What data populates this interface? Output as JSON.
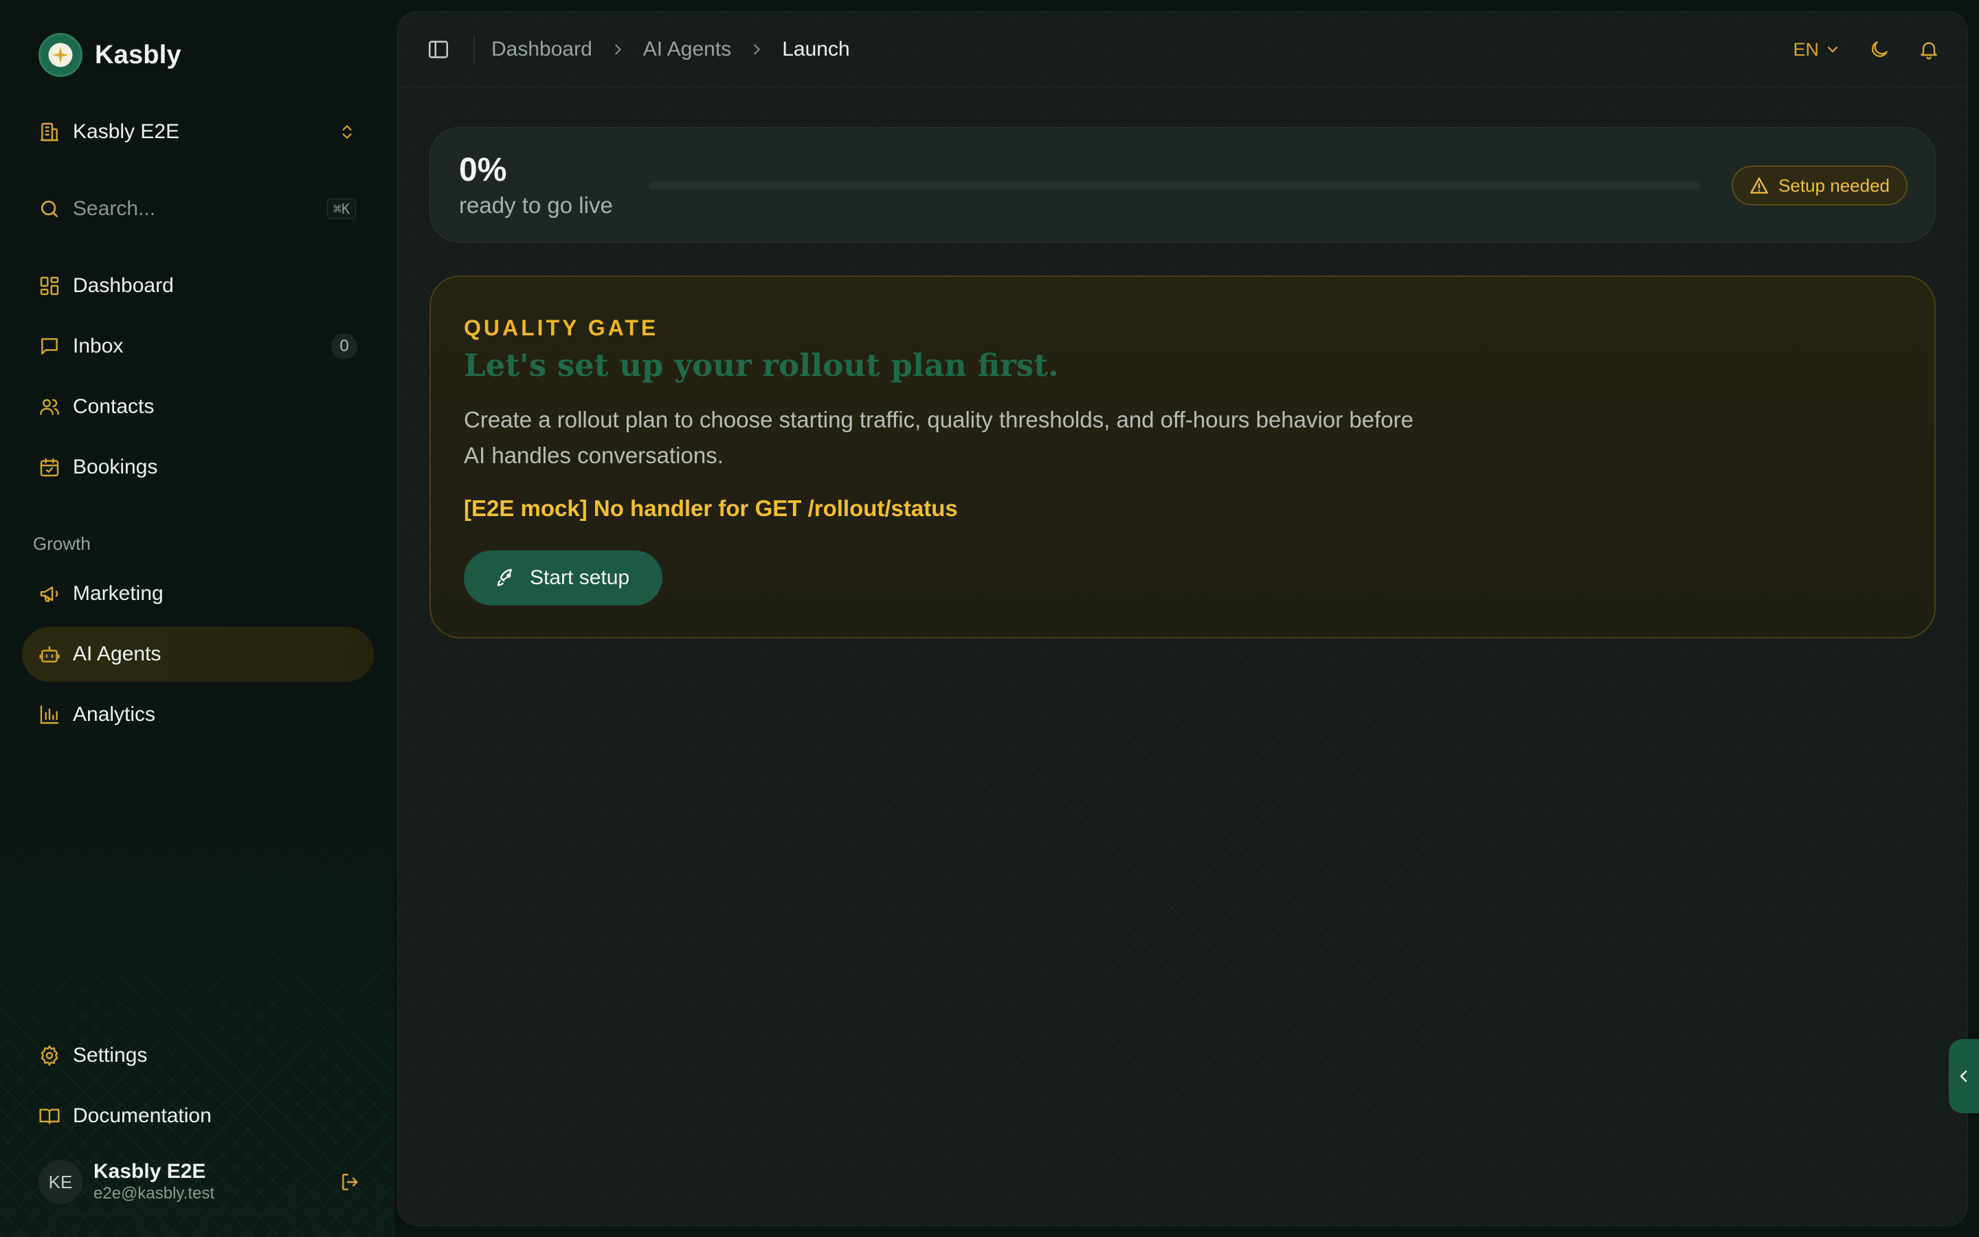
{
  "app": {
    "name": "Kasbly"
  },
  "workspace": {
    "name": "Kasbly E2E"
  },
  "search": {
    "placeholder": "Search...",
    "shortcut": "⌘K"
  },
  "nav": {
    "primary": [
      {
        "label": "Dashboard",
        "icon": "dashboard-icon"
      },
      {
        "label": "Inbox",
        "icon": "inbox-icon",
        "badge": "0"
      },
      {
        "label": "Contacts",
        "icon": "contacts-icon"
      },
      {
        "label": "Bookings",
        "icon": "calendar-icon"
      }
    ],
    "section_label": "Growth",
    "growth": [
      {
        "label": "Marketing",
        "icon": "megaphone-icon"
      },
      {
        "label": "AI Agents",
        "icon": "bot-icon",
        "active": true
      },
      {
        "label": "Analytics",
        "icon": "bar-chart-icon"
      }
    ],
    "footer": [
      {
        "label": "Settings",
        "icon": "gear-icon"
      },
      {
        "label": "Documentation",
        "icon": "book-icon"
      }
    ]
  },
  "user": {
    "initials": "KE",
    "name": "Kasbly E2E",
    "email": "e2e@kasbly.test"
  },
  "breadcrumb": [
    "Dashboard",
    "AI Agents",
    "Launch"
  ],
  "header": {
    "language": "EN"
  },
  "progress": {
    "value": "0%",
    "fraction": 0,
    "label": "ready to go live",
    "badge": "Setup needed"
  },
  "gate": {
    "eyebrow": "QUALITY GATE",
    "title": "Let's set up your rollout plan first.",
    "description": "Create a rollout plan to choose starting traffic, quality thresholds, and off-hours behavior before AI handles conversations.",
    "error": "[E2E mock] No handler for GET /rollout/status",
    "button": "Start setup"
  },
  "colors": {
    "accent_gold": "#d9a52c",
    "brand_green": "#1d5a43",
    "warning_text": "#f2c02e",
    "background": "#0b1410"
  }
}
